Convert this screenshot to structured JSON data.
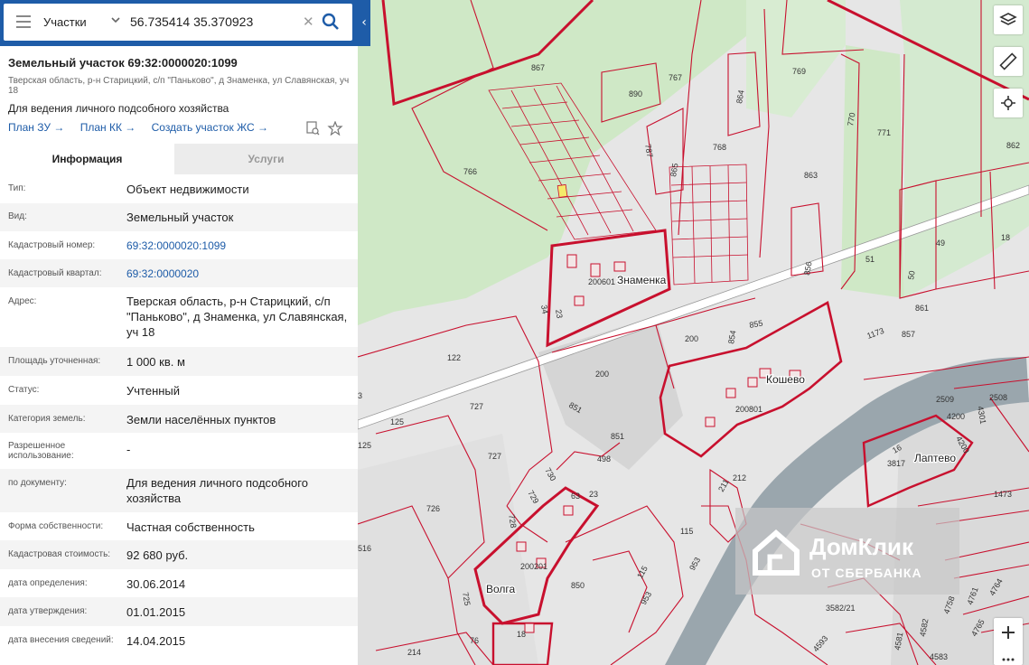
{
  "search": {
    "layer": "Участки",
    "query": "56.735414 35.370923"
  },
  "parcel": {
    "title": "Земельный участок 69:32:0000020:1099",
    "address_line": "Тверская область, р-н Старицкий, с/п \"Паньково\", д Знаменка, ул Славянская, уч 18",
    "purpose": "Для ведения личного подсобного хозяйства",
    "links": [
      "План ЗУ →",
      "План КК →",
      "Создать участок ЖС →"
    ]
  },
  "tabs": {
    "info": "Информация",
    "services": "Услуги"
  },
  "props": [
    {
      "k": "Тип:",
      "v": "Объект недвижимости"
    },
    {
      "k": "Вид:",
      "v": "Земельный участок"
    },
    {
      "k": "Кадастровый номер:",
      "v": "69:32:0000020:1099"
    },
    {
      "k": "Кадастровый квартал:",
      "v": "69:32:0000020"
    },
    {
      "k": "Адрес:",
      "v": "Тверская область, р-н Старицкий, с/п \"Паньково\", д Знаменка, ул Славянская, уч 18"
    },
    {
      "k": "Площадь уточненная:",
      "v": "1 000 кв. м"
    },
    {
      "k": "Статус:",
      "v": "Учтенный"
    },
    {
      "k": "Категория земель:",
      "v": "Земли населённых пунктов"
    },
    {
      "k": "Разрешенное использование:",
      "v": "-"
    },
    {
      "k": "по документу:",
      "v": "Для ведения личного подсобного хозяйства"
    },
    {
      "k": "Форма собственности:",
      "v": "Частная собственность"
    },
    {
      "k": "Кадастровая стоимость:",
      "v": "92 680 руб."
    },
    {
      "k": "дата определения:",
      "v": "30.06.2014"
    },
    {
      "k": "дата утверждения:",
      "v": "01.01.2015"
    },
    {
      "k": "дата внесения сведений:",
      "v": "14.04.2015"
    }
  ],
  "map": {
    "places": {
      "znamenka": "Знаменка",
      "koshevo": "Кошево",
      "volga": "Волга",
      "laptevo": "Лаптево"
    },
    "labels": {
      "l867": "867",
      "l890": "890",
      "l767": "767",
      "l769": "769",
      "l864": "864",
      "l770": "770",
      "l771": "771",
      "l862": "862",
      "l766": "766",
      "l787": "787",
      "l768": "768",
      "l865": "865",
      "l863": "863",
      "l49": "49",
      "l18a": "18",
      "l51": "51",
      "l50": "50",
      "l856": "856",
      "l861": "861",
      "l1173": "1173",
      "l857": "857",
      "l200601": "200601",
      "l34": "34",
      "l23a": "23",
      "l855": "855",
      "l854": "854",
      "l200a": "200",
      "l122": "122",
      "l200b": "200",
      "l727a": "727",
      "l851a": "851",
      "l851b": "851",
      "l200801": "200801",
      "l2509": "2509",
      "l2508": "2508",
      "l4200a": "4200",
      "l4301": "4301",
      "l4200b": "4200",
      "l3817": "3817",
      "l16": "16",
      "l125a": "125",
      "l125b": "125",
      "l498": "498",
      "l727b": "727",
      "l730": "730",
      "l729": "729",
      "l63": "63",
      "l23b": "23",
      "l212": "212",
      "l211": "211",
      "l1473": "1473",
      "l726": "726",
      "l728": "728",
      "l115a": "115",
      "l850": "850",
      "l115b": "115",
      "l953a": "953",
      "l953b": "953",
      "l200201": "200201",
      "l725": "725",
      "l18b": "18",
      "l214": "214",
      "l76": "76",
      "l3582": "3582/21",
      "l4593": "4593",
      "l4581": "4581",
      "l4583": "4583",
      "l4758": "4758",
      "l4761": "4761",
      "l4764": "4764",
      "l4582": "4582",
      "l4765": "4765",
      "l516": "516",
      "l3": "3"
    }
  },
  "watermark": {
    "title": "ДомКлик",
    "subtitle": "ОТ СБЕРБАНКА"
  },
  "colors": {
    "brand": "#1e5ca8",
    "boundary": "#c8102e",
    "river": "#9aa6ad"
  }
}
